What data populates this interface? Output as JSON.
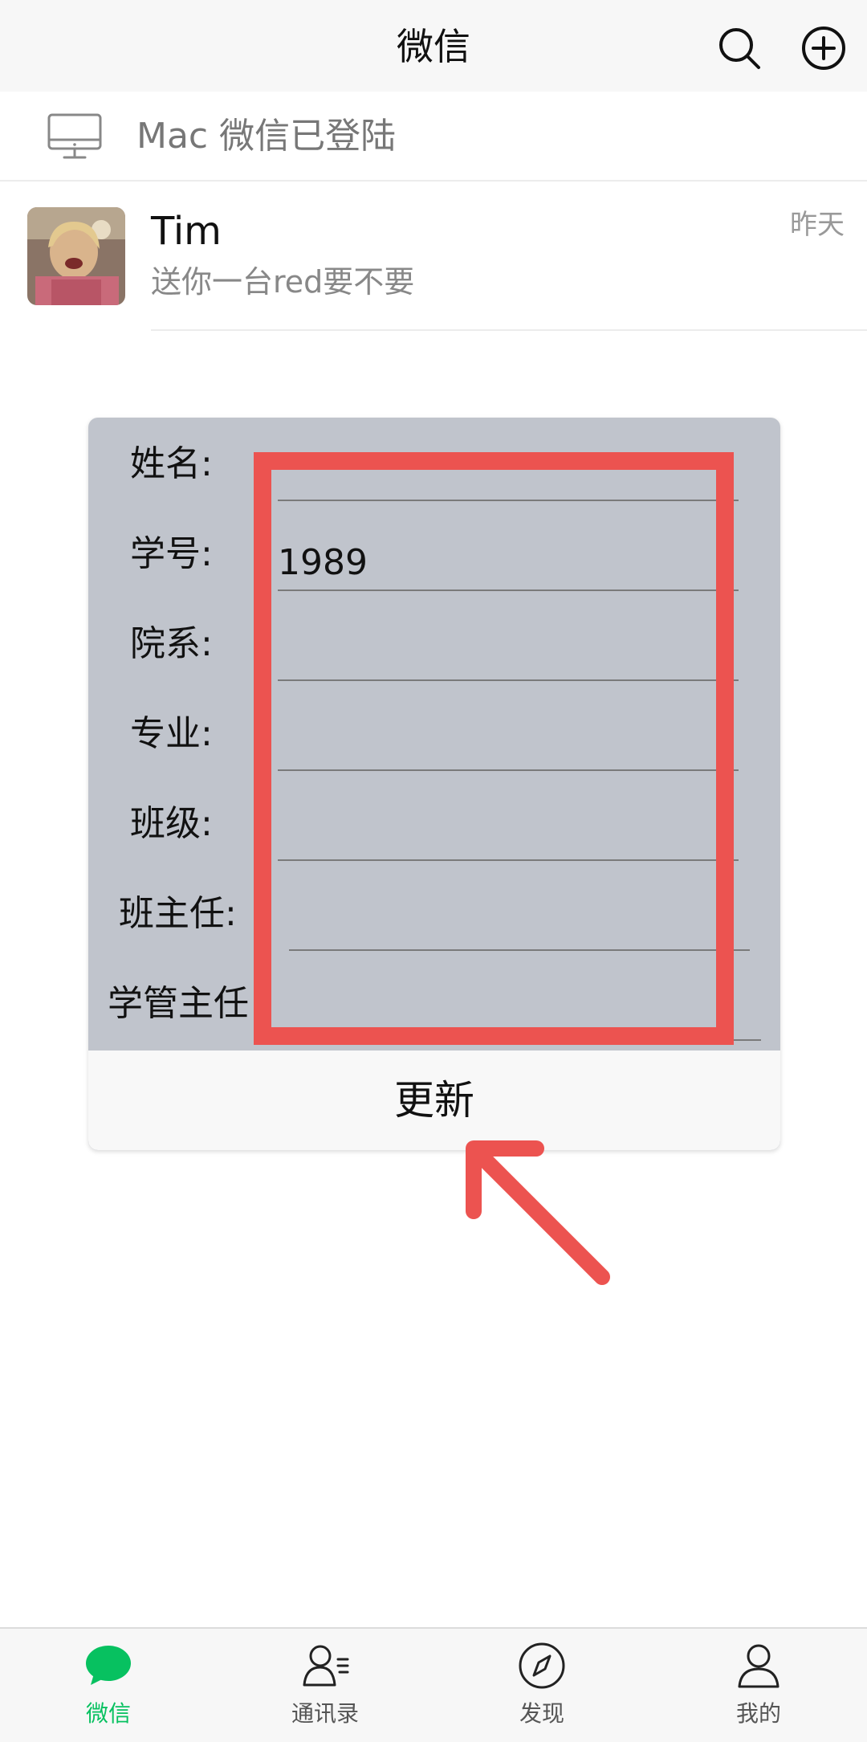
{
  "header": {
    "title": "微信",
    "search_icon": "search-icon",
    "add_icon": "add-circle-icon"
  },
  "login_banner": {
    "icon": "monitor-icon",
    "text": "Mac 微信已登陆"
  },
  "chat": {
    "name": "Tim",
    "preview": "送你一台red要不要",
    "time": "昨天"
  },
  "dialog": {
    "fields": [
      {
        "label": "姓名:",
        "value": ""
      },
      {
        "label": "学号:",
        "value": "1989"
      },
      {
        "label": "院系:",
        "value": ""
      },
      {
        "label": "专业:",
        "value": ""
      },
      {
        "label": "班级:",
        "value": ""
      },
      {
        "label": "班主任:",
        "value": ""
      },
      {
        "label": "学管主任",
        "value": ""
      }
    ],
    "update_label": "更新"
  },
  "annotation": {
    "color": "#ec5350"
  },
  "tabbar": {
    "active_color": "#07c160",
    "tabs": [
      {
        "label": "微信",
        "icon": "chat-bubble-icon",
        "active": true
      },
      {
        "label": "通讯录",
        "icon": "contacts-icon",
        "active": false
      },
      {
        "label": "发现",
        "icon": "compass-icon",
        "active": false
      },
      {
        "label": "我的",
        "icon": "person-icon",
        "active": false
      }
    ]
  }
}
